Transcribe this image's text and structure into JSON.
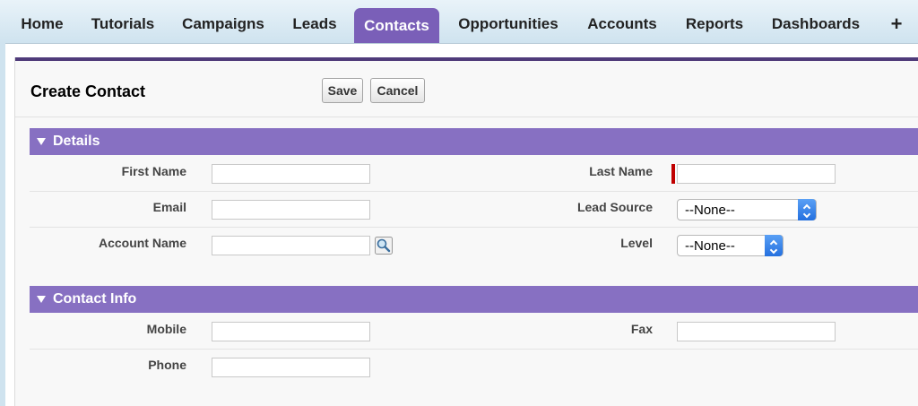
{
  "tabs": [
    {
      "label": "Home"
    },
    {
      "label": "Tutorials"
    },
    {
      "label": "Campaigns"
    },
    {
      "label": "Leads"
    },
    {
      "label": "Contacts"
    },
    {
      "label": "Opportunities"
    },
    {
      "label": "Accounts"
    },
    {
      "label": "Reports"
    },
    {
      "label": "Dashboards"
    },
    {
      "label": "+"
    }
  ],
  "active_tab": "Contacts",
  "page": {
    "title": "Create Contact",
    "save_label": "Save",
    "cancel_label": "Cancel"
  },
  "details": {
    "title": "Details",
    "first_name_label": "First Name",
    "first_name_value": "",
    "last_name_label": "Last Name",
    "last_name_value": "",
    "email_label": "Email",
    "email_value": "",
    "lead_source_label": "Lead Source",
    "lead_source_value": "--None--",
    "account_name_label": "Account Name",
    "account_name_value": "",
    "level_label": "Level",
    "level_value": "--None--"
  },
  "contact_info": {
    "title": "Contact Info",
    "mobile_label": "Mobile",
    "mobile_value": "",
    "fax_label": "Fax",
    "fax_value": "",
    "phone_label": "Phone",
    "phone_value": ""
  },
  "colors": {
    "accent": "#7a5fb8",
    "section_bar": "#8770c2",
    "required": "#c00000"
  }
}
